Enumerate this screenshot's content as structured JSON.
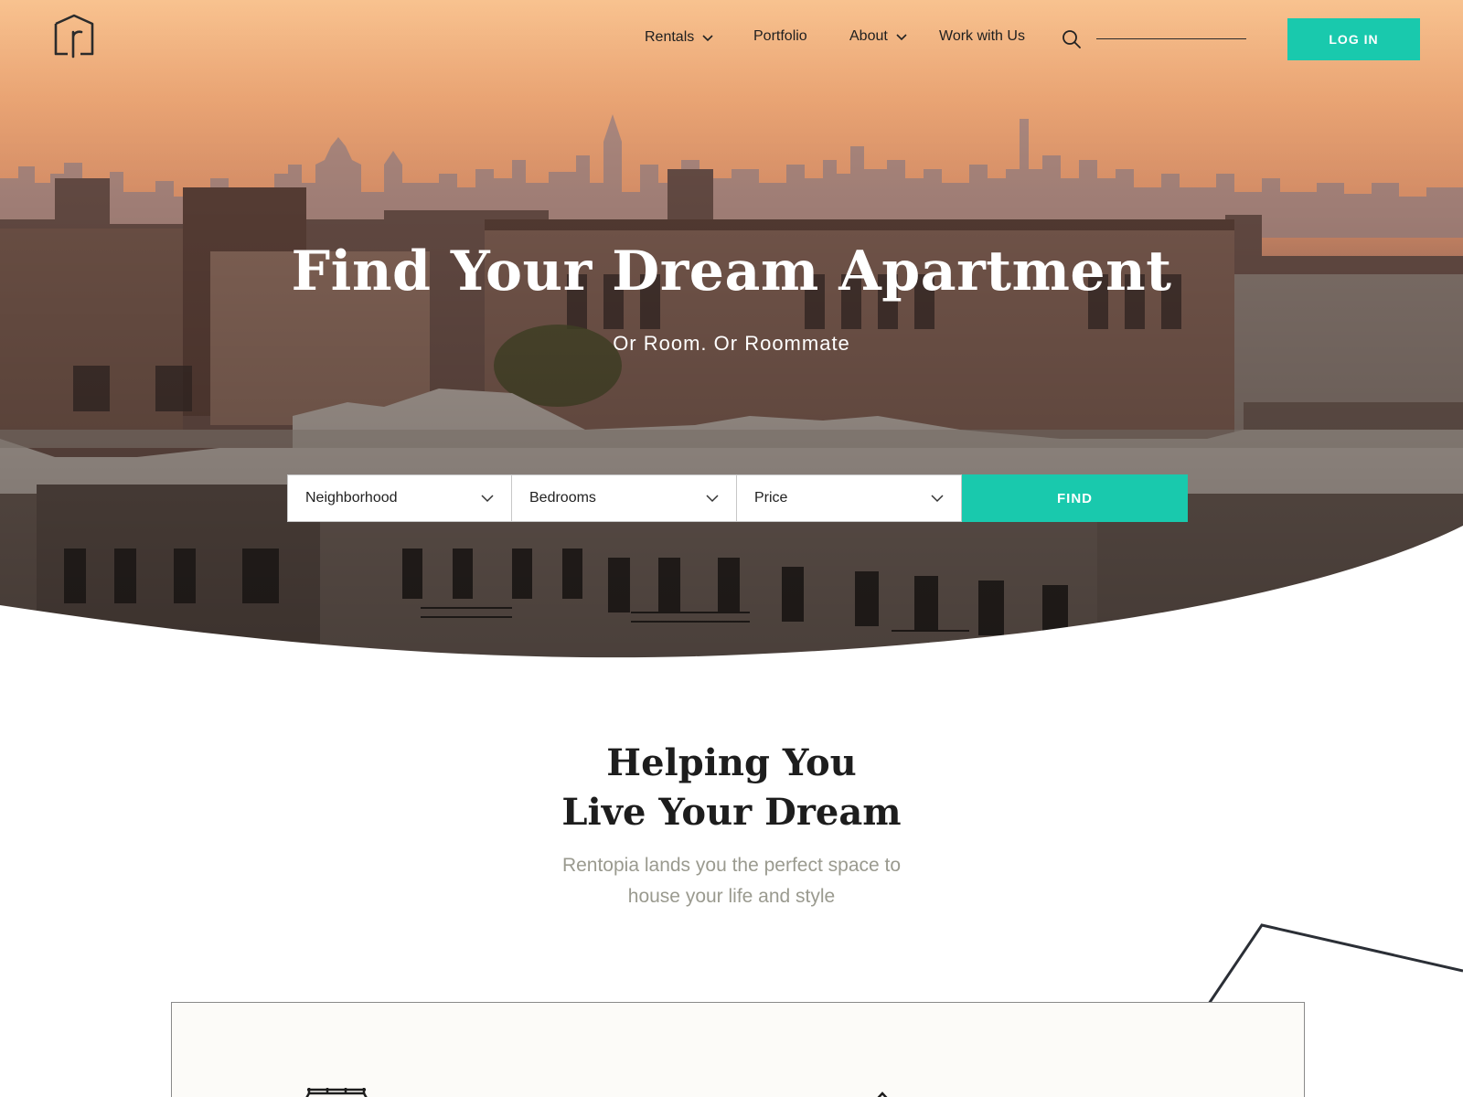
{
  "brand": {
    "logo_icon": "rentopia-house-r-logo"
  },
  "nav": {
    "items": [
      {
        "label": "Rentals",
        "has_dropdown": true
      },
      {
        "label": "Portfolio",
        "has_dropdown": false
      },
      {
        "label": "About",
        "has_dropdown": true
      },
      {
        "label": "Work with Us",
        "has_dropdown": false
      }
    ],
    "search_icon": "search-icon",
    "login_label": "LOG IN"
  },
  "hero": {
    "title": "Find Your Dream Apartment",
    "subtitle": "Or Room. Or Roommate",
    "filters": [
      {
        "label": "Neighborhood"
      },
      {
        "label": "Bedrooms"
      },
      {
        "label": "Price"
      }
    ],
    "find_label": "FIND"
  },
  "intro": {
    "title_line1": "Helping You",
    "title_line2": "Live Your Dream",
    "text_line1": "Rentopia lands you the perfect space to",
    "text_line2": "house your life and style"
  },
  "colors": {
    "accent": "#19c9ad",
    "sky_top": "#f6b07c",
    "text_dark": "#1d1d1d",
    "text_muted": "#9a9a8f"
  }
}
